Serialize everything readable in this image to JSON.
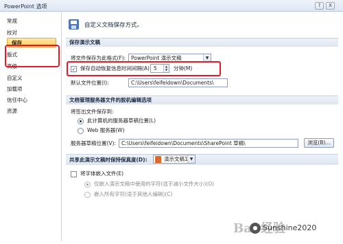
{
  "window": {
    "title": "PowerPoint 选项",
    "help_label": "?",
    "close_label": "X"
  },
  "sidebar": {
    "items": [
      {
        "label": "常规"
      },
      {
        "label": "校对"
      },
      {
        "label": "保存"
      },
      {
        "label": "版式"
      },
      {
        "label": "高级"
      },
      {
        "label": "自定义"
      },
      {
        "label": "加载项"
      },
      {
        "label": "信任中心"
      },
      {
        "label": "资源"
      }
    ],
    "selected": "保存"
  },
  "header": {
    "text": "自定义文档保存方式。"
  },
  "save_presentations": {
    "section_title": "保存演示文稿",
    "format_label": "将文件保存为此格式(F):",
    "format_value": "PowerPoint 演示文稿",
    "autorecover_label": "保存自动恢复信息时间间隔(A)",
    "autorecover_checked": true,
    "autorecover_minutes": "5",
    "minutes_label": "分钟(M)",
    "default_location_label": "默认文件位置(I):",
    "default_location_value": "C:\\Users\\feifeidown\\Documents\\"
  },
  "server_files": {
    "section_title": "文档管理服务器文件的脱机编辑选项",
    "checkout_label": "将签出文件保存到:",
    "option_local": "此计算机的服务器草稿位置(L)",
    "option_server": "Web 服务器(W)",
    "drafts_label": "服务器草稿位置(V):",
    "drafts_value": "C:\\Users\\feifeidown\\Documents\\SharePoint 草稿\\",
    "browse_label": "浏览(B)..."
  },
  "fidelity": {
    "section_title": "共享此演示文稿时保持保真度(D):",
    "presentation_value": "演示文稿1",
    "embed_fonts_label": "将字体嵌入文件(E)",
    "embed_only_used": "仅嵌入演示文稿中使用的字符(适于减小文件大小)(O)",
    "embed_all": "嵌入所有字符(适于其他人编辑)(C)"
  },
  "watermark": {
    "text": "Sunshine2020",
    "logo_text": "Bai 经验"
  },
  "colors": {
    "highlight_border": "#e2192b",
    "selected_tab": "#ffc95a",
    "accent": "#4b76b8"
  }
}
